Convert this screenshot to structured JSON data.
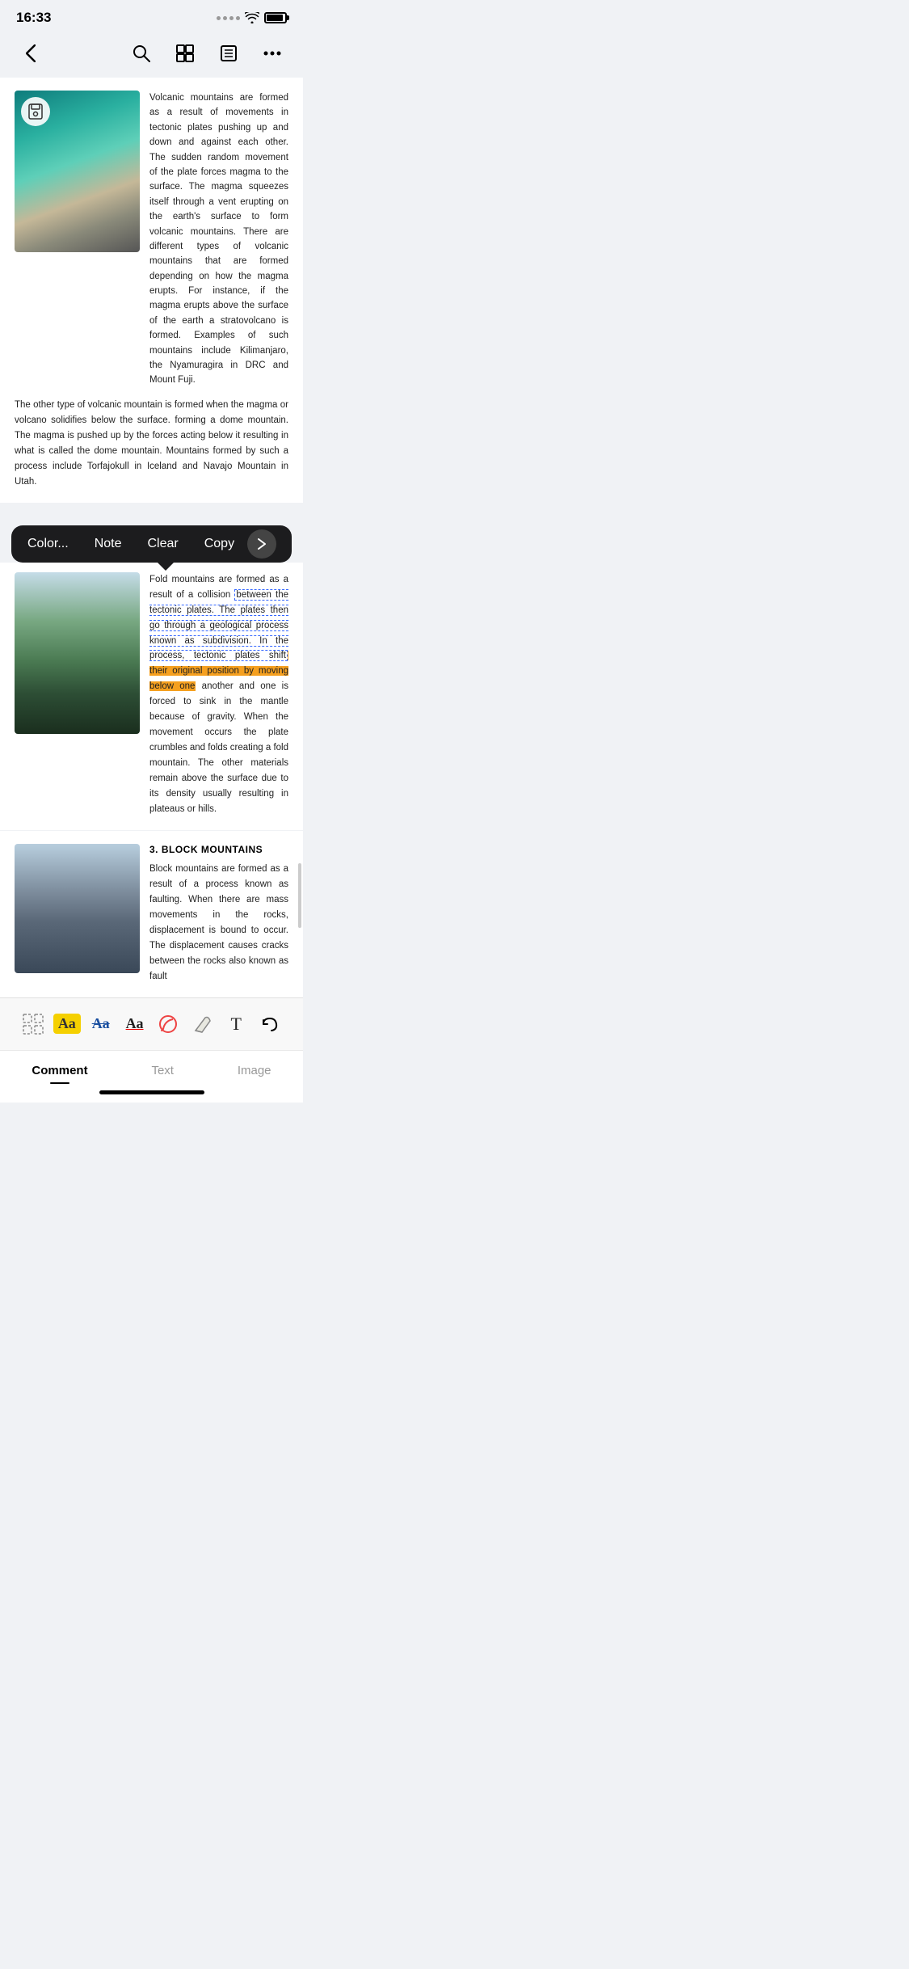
{
  "statusBar": {
    "time": "16:33"
  },
  "toolbar": {
    "back": "‹",
    "search": "search",
    "grid": "grid",
    "list": "list",
    "more": "more"
  },
  "article1": {
    "text1": "Volcanic mountains are formed as a result of movements in tectonic plates pushing up and down and against each other. The sudden random movement of the plate forces magma to the surface. The magma squeezes itself through a vent erupting on the earth's surface to form volcanic mountains. There are different types of volcanic mountains that are formed depending on how the magma erupts. For instance, if the magma erupts above the surface of the earth a stratovolcano is formed. Examples of such mountains include Kilimanjaro, the Nyamuragira in DRC and Mount Fuji.",
    "text2": "The other type of volcanic mountain is formed when the magma or volcano solidifies below the surface. forming a dome mountain. The magma is pushed up by the forces acting below it resulting in what is called the dome mountain. Mountains formed by such a process include Torfajokull in Iceland and Navajo Mountain in Utah."
  },
  "contextMenu": {
    "items": [
      "Color...",
      "Note",
      "Clear",
      "Copy"
    ],
    "arrowIcon": "▶"
  },
  "article2": {
    "textBefore": "Fold mountains are formed as a result of a collision ",
    "textHighlightedDashed": "between the tectonic plates. The plates then go through a geological process known as subdivision. In the process, tectonic plates shift",
    "textHighlightedOrange": " their original position by moving below one",
    "textAfter": " another and one is forced to sink in the mantle because of gravity. When the movement occurs the plate crumbles and folds creating a fold mountain. The other materials remain above the surface due to its density usually resulting in plateaus or hills."
  },
  "article3": {
    "heading": "3. BLOCK MOUNTAINS",
    "text": "Block mountains are formed as a result of a process known as faulting. When there are mass movements in the rocks, displacement is bound to occur. The displacement causes cracks between the rocks also known as fault"
  },
  "bottomToolbar": {
    "tools": [
      "selection",
      "highlight-yellow",
      "highlight-strikethrough",
      "highlight-underline",
      "marker",
      "eraser",
      "text",
      "undo"
    ]
  },
  "tabs": {
    "items": [
      "Comment",
      "Text",
      "Image"
    ],
    "active": 0
  }
}
